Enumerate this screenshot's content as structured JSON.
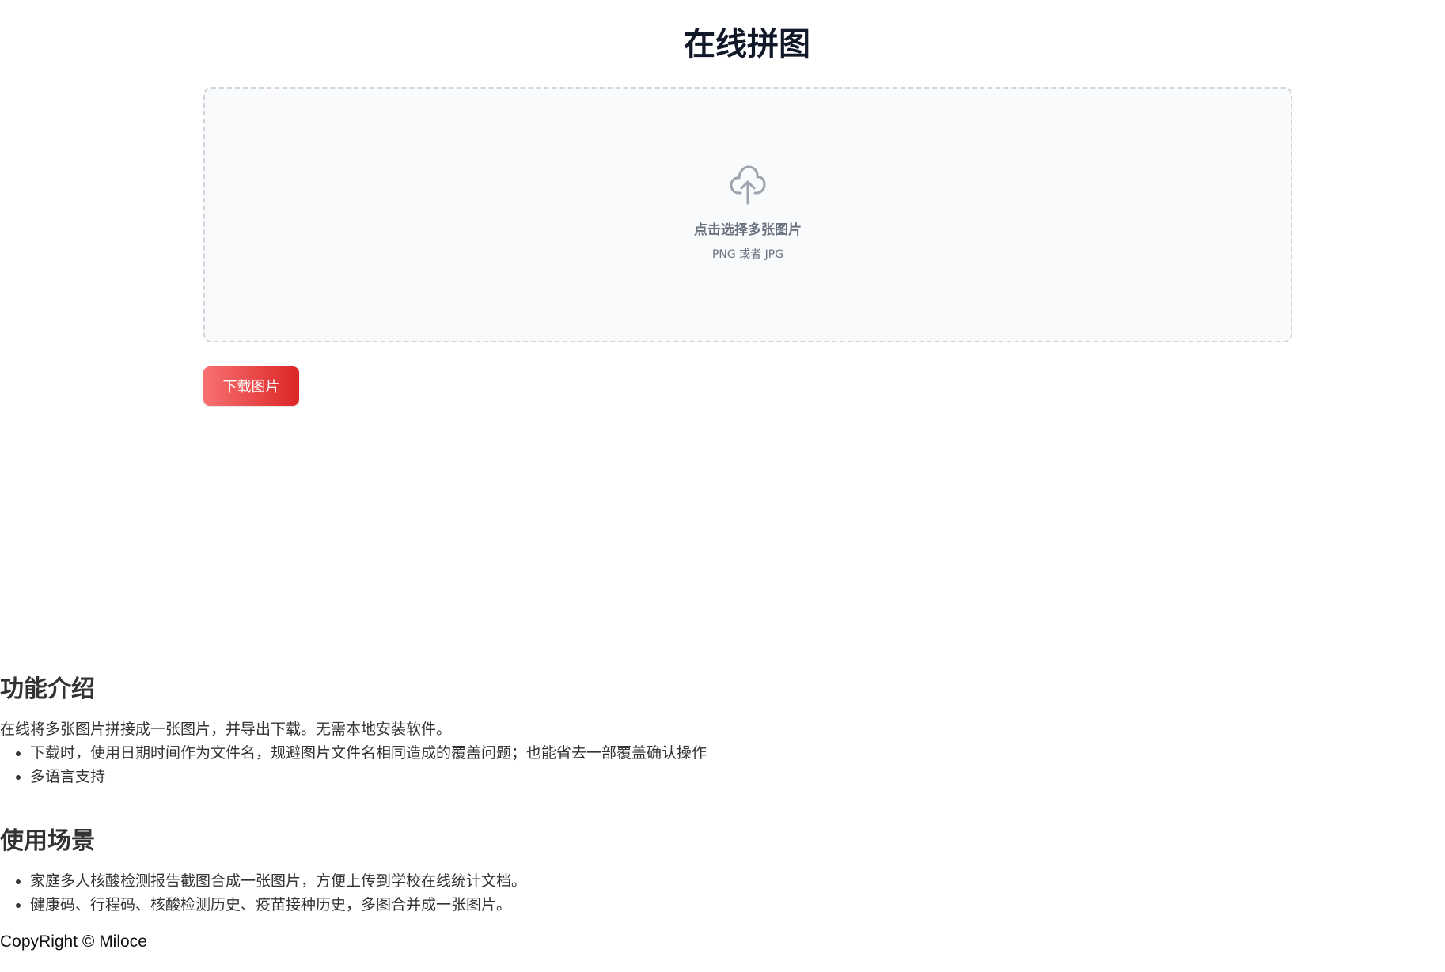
{
  "header": {
    "title": "在线拼图"
  },
  "upload": {
    "icon": "cloud-upload-icon",
    "label": "点击选择多张图片",
    "hint": "PNG 或者 JPG"
  },
  "actions": {
    "download_label": "下载图片"
  },
  "features": {
    "heading": "功能介绍",
    "intro": "在线将多张图片拼接成一张图片，并导出下载。无需本地安装软件。",
    "items": [
      "下载时，使用日期时间作为文件名，规避图片文件名相同造成的覆盖问题；也能省去一部覆盖确认操作",
      "多语言支持"
    ]
  },
  "scenarios": {
    "heading": "使用场景",
    "items": [
      "家庭多人核酸检测报告截图合成一张图片，方便上传到学校在线统计文档。",
      "健康码、行程码、核酸检测历史、疫苗接种历史，多图合并成一张图片。"
    ]
  },
  "footer": {
    "copyright": "CopyRight © Miloce"
  },
  "colors": {
    "title": "#111827",
    "dropzone_border": "#d1d5db",
    "dropzone_bg": "#f9fafb",
    "muted_text": "#6b7280",
    "button_gradient_start": "#f87171",
    "button_gradient_end": "#dc2626"
  }
}
